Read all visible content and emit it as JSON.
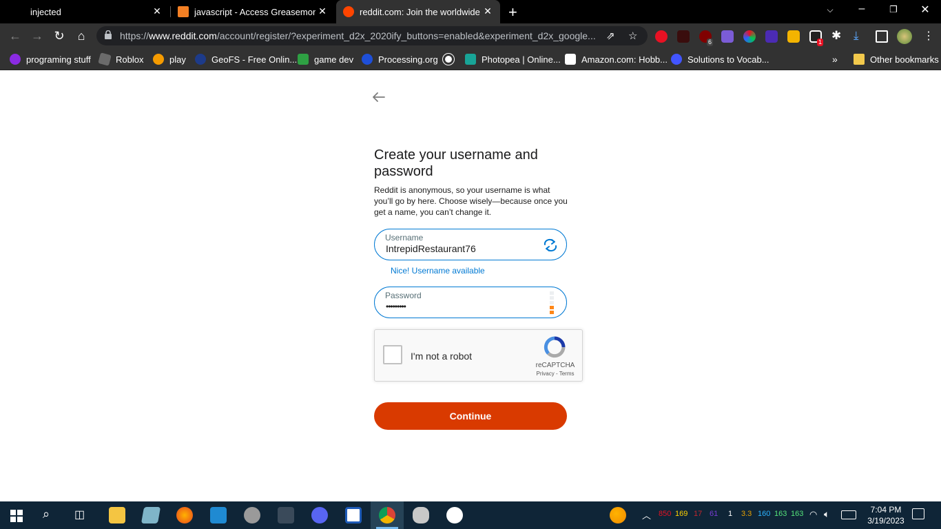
{
  "tabs": [
    {
      "title": "injected",
      "active": false
    },
    {
      "title": "javascript - Access Greasemonkey",
      "active": false
    },
    {
      "title": "reddit.com: Join the worldwide conversation",
      "active": true
    }
  ],
  "toolbar": {
    "url_scheme": "https://",
    "url_host": "www.reddit.com",
    "url_path": "/account/register/?experiment_d2x_2020ify_buttons=enabled&experiment_d2x_google..."
  },
  "extensions": {
    "badge_6": "6",
    "badge_1": "1"
  },
  "bookmarks": [
    {
      "label": "programing stuff",
      "icon": "purple-circle-icon"
    },
    {
      "label": "Roblox",
      "icon": "roblox-icon"
    },
    {
      "label": "play",
      "icon": "play-icon"
    },
    {
      "label": "GeoFS - Free Onlin...",
      "icon": "geofs-icon"
    },
    {
      "label": "game dev",
      "icon": "green-plus-icon"
    },
    {
      "label": "Processing.org",
      "icon": "processing-icon"
    },
    {
      "label": "",
      "icon": "globe-icon"
    },
    {
      "label": "Photopea | Online...",
      "icon": "photopea-icon"
    },
    {
      "label": "Amazon.com: Hobb...",
      "icon": "amazon-icon"
    },
    {
      "label": "Solutions to Vocab...",
      "icon": "quizlet-icon"
    }
  ],
  "other_bookmarks": "Other bookmarks",
  "more_bookmarks": "»",
  "page": {
    "title": "Create your username and password",
    "description": "Reddit is anonymous, so your username is what you’ll go by here. Choose wisely—because once you get a name, you can’t change it.",
    "username_label": "Username",
    "username_value": "IntrepidRestaurant76",
    "username_status": "Nice! Username available",
    "password_label": "Password",
    "password_value": "•••••••••",
    "password_strength_level": 0.33,
    "captcha_label": "I'm not a robot",
    "captcha_brand": "reCAPTCHA",
    "captcha_links": "Privacy - Terms",
    "continue_label": "Continue",
    "accent_color": "#0079d3",
    "button_color": "#d93a00"
  },
  "taskbar": {
    "tray_numbers": [
      {
        "text": "850",
        "color": "#e81123"
      },
      {
        "text": "169",
        "color": "#ffd200"
      },
      {
        "text": "17",
        "color": "#c4262e"
      },
      {
        "text": "61",
        "color": "#7a3cd6"
      },
      {
        "text": "1",
        "color": "#ffffff"
      },
      {
        "text": "3.3",
        "color": "#e8a100"
      },
      {
        "text": "160",
        "color": "#2db3ff"
      },
      {
        "text": "163",
        "color": "#54e37a"
      },
      {
        "text": "163",
        "color": "#54e37a"
      }
    ],
    "time": "7:04 PM",
    "date": "3/19/2023"
  }
}
